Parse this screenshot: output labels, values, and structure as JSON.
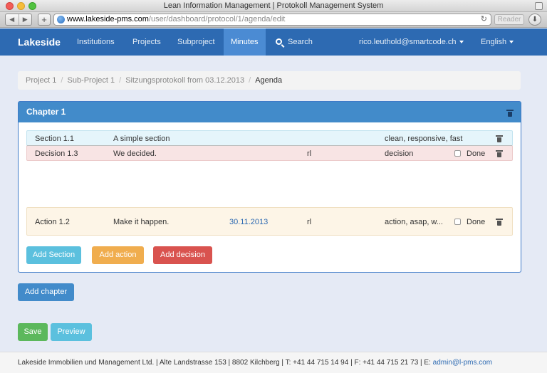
{
  "window": {
    "title": "Lean Information Management | Protokoll Management System"
  },
  "browser": {
    "url_host": "www.lakeside-pms.com",
    "url_path": "/user/dashboard/protocol/1/agenda/edit",
    "reader_label": "Reader",
    "back_glyph": "◀",
    "forward_glyph": "▶",
    "plus_glyph": "+",
    "reload_glyph": "↻",
    "download_glyph": "⬇"
  },
  "navbar": {
    "brand": "Lakeside",
    "items": [
      {
        "label": "Institutions"
      },
      {
        "label": "Projects"
      },
      {
        "label": "Subproject"
      },
      {
        "label": "Minutes",
        "active": true
      },
      {
        "label": "Search"
      }
    ],
    "user": "rico.leuthold@smartcode.ch",
    "language": "English"
  },
  "breadcrumb": [
    "Project 1",
    "Sub-Project 1",
    "Sitzungsprotokoll from 03.12.2013",
    "Agenda"
  ],
  "chapter": {
    "title": "Chapter 1",
    "section": {
      "number": "Section 1.1",
      "text": "A simple section",
      "tags": "clean, responsive, fast"
    },
    "decision": {
      "number": "Decision 1.3",
      "text": "We decided.",
      "owner": "rl",
      "tags": "decision",
      "done_label": "Done"
    },
    "action": {
      "number": "Action 1.2",
      "text": "Make it happen.",
      "date": "30.11.2013",
      "owner": "rl",
      "tags": "action, asap, w...",
      "done_label": "Done"
    },
    "buttons": {
      "add_section": "Add Section",
      "add_action": "Add action",
      "add_decision": "Add decision"
    }
  },
  "add_chapter": "Add chapter",
  "save": "Save",
  "preview": "Preview",
  "footer": {
    "text": "Lakeside Immobilien und Management Ltd. | Alte Landstrasse 153 | 8802 Kilchberg | T: +41 44 715 14 94 | F: +41 44 715 21 73 | E: ",
    "email": "admin@l-pms.com"
  },
  "colors": {
    "navbar": "#2d6ab2",
    "active": "#4b8bd3",
    "panel_head": "#428bca",
    "background": "#e5eaf5"
  }
}
